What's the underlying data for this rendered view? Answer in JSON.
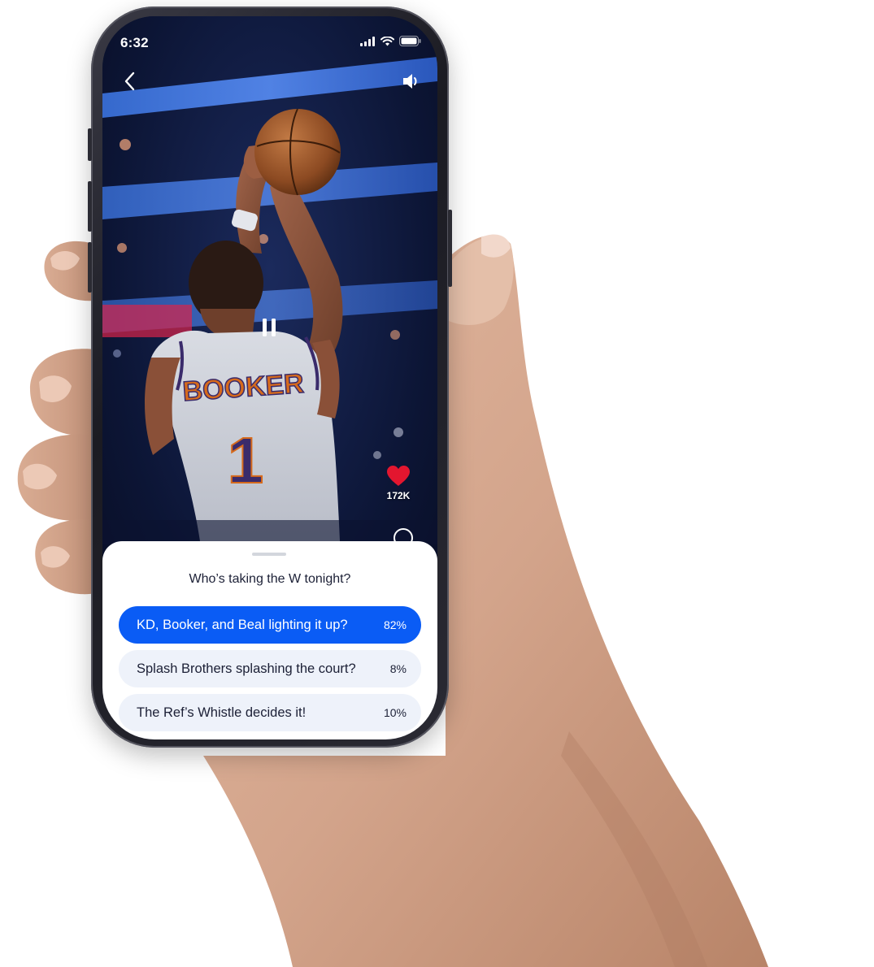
{
  "status_bar": {
    "time": "6:32",
    "icons": [
      "cellular-signal-icon",
      "wifi-icon",
      "battery-icon"
    ]
  },
  "video": {
    "top_controls": {
      "back_icon": "chevron-left-icon",
      "sound_icon": "speaker-icon"
    },
    "player_jersey_name": "BOOKER",
    "player_jersey_number": "1",
    "playback_icon": "pause-icon",
    "likes": {
      "icon": "heart-icon",
      "count": "172K",
      "color": "#e3162f"
    }
  },
  "poll": {
    "question": "Who’s taking the W tonight?",
    "options": [
      {
        "label": "KD, Booker, and Beal lighting it up?",
        "percent": "82%",
        "selected": true
      },
      {
        "label": "Splash Brothers splashing the court?",
        "percent": "8%",
        "selected": false
      },
      {
        "label": "The Ref’s Whistle decides it!",
        "percent": "10%",
        "selected": false
      }
    ],
    "accent_color": "#0a5cf5",
    "option_bg_color": "#eef2fa"
  }
}
